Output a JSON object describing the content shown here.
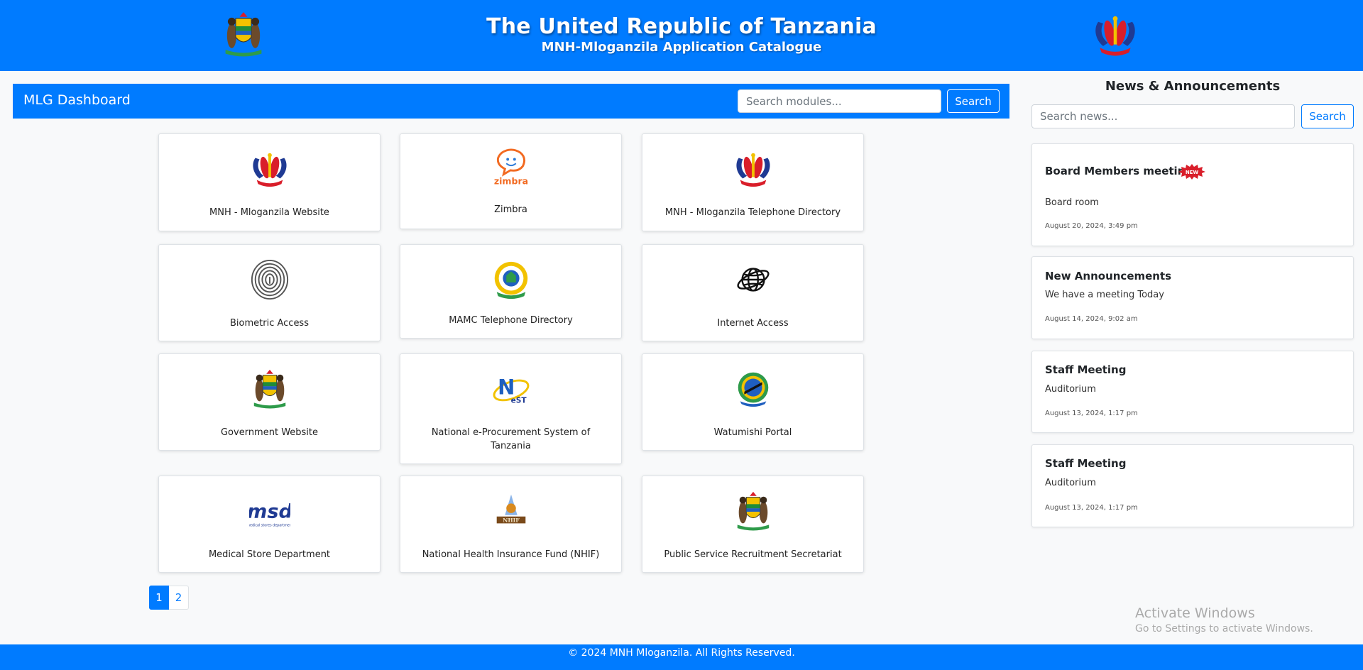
{
  "header": {
    "title": "The United Republic of Tanzania",
    "subtitle": "MNH-Mloganzila Application Catalogue"
  },
  "dashboard": {
    "title": "MLG Dashboard",
    "search_placeholder": "Search modules...",
    "search_label": "Search"
  },
  "modules": [
    {
      "label": "MNH - Mloganzila Website",
      "icon": "mnh-logo-icon"
    },
    {
      "label": "Zimbra",
      "icon": "zimbra-logo-icon"
    },
    {
      "label": "MNH - Mloganzila Telephone Directory",
      "icon": "mnh-logo-icon"
    },
    {
      "label": "Biometric Access",
      "icon": "fingerprint-icon"
    },
    {
      "label": "MAMC Telephone Directory",
      "icon": "mamc-logo-icon"
    },
    {
      "label": "Internet Access",
      "icon": "globe-icon"
    },
    {
      "label": "Government Website",
      "icon": "coat-of-arms-icon"
    },
    {
      "label": "National e-Procurement System of Tanzania",
      "icon": "nest-logo-icon"
    },
    {
      "label": "Watumishi Portal",
      "icon": "watumishi-logo-icon"
    },
    {
      "label": "Medical Store Department",
      "icon": "msd-logo-icon"
    },
    {
      "label": "National Health Insurance Fund (NHIF)",
      "icon": "nhif-logo-icon"
    },
    {
      "label": "Public Service Recruitment Secretariat",
      "icon": "coat-of-arms-icon"
    }
  ],
  "pagination": {
    "pages": [
      "1",
      "2"
    ],
    "current": "1"
  },
  "news": {
    "heading": "News & Announcements",
    "search_placeholder": "Search news...",
    "search_label": "Search",
    "items": [
      {
        "title": "Board Members meeting",
        "body": "Board room",
        "date": "August 20, 2024, 3:49 pm",
        "badge": "NEW"
      },
      {
        "title": "New Announcements",
        "body": "We have a meeting Today",
        "date": "August 14, 2024, 9:02 am"
      },
      {
        "title": "Staff Meeting",
        "body": "Auditorium",
        "date": "August 13, 2024, 1:17 pm"
      },
      {
        "title": "Staff Meeting",
        "body": "Auditorium",
        "date": "August 13, 2024, 1:17 pm"
      }
    ]
  },
  "watermark": {
    "line1": "Activate Windows",
    "line2": "Go to Settings to activate Windows."
  },
  "footer": {
    "text": "© 2024 MNH Mloganzila. All Rights Reserved."
  },
  "colors": {
    "primary": "#007bff",
    "background": "#f8f9fa"
  }
}
